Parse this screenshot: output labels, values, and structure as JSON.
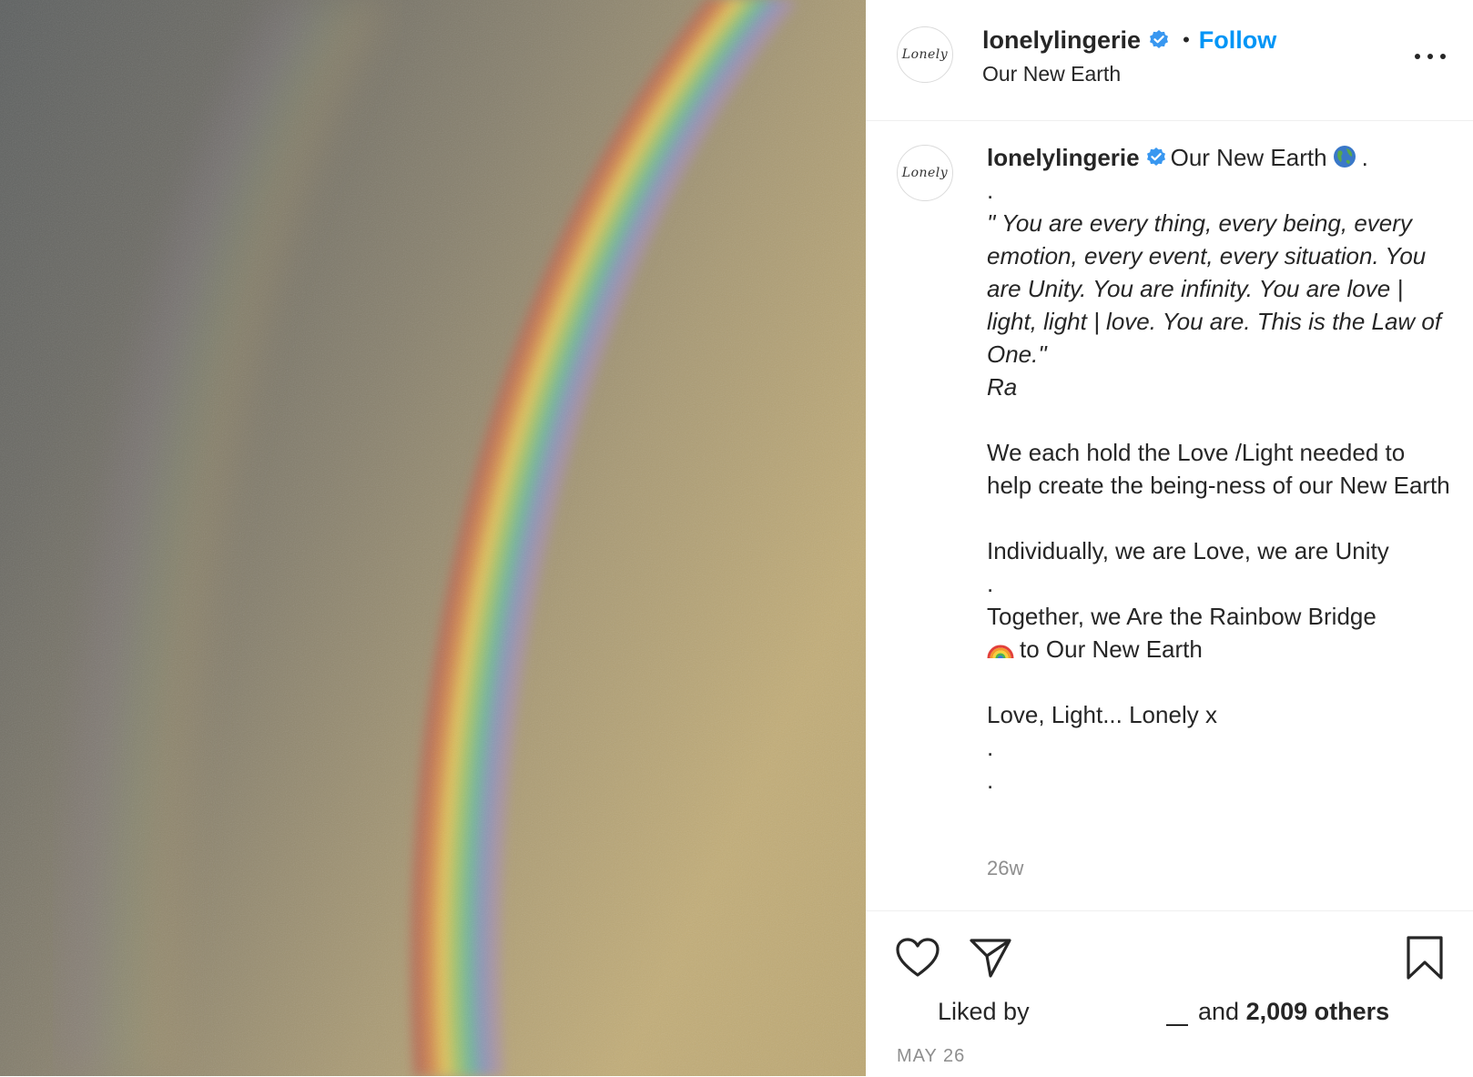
{
  "colors": {
    "accent": "#0095f6",
    "verified": "#3897f0",
    "text": "#262626",
    "muted": "#8e8e8e"
  },
  "photo": {
    "subject": "rainbow-arc-photo"
  },
  "header": {
    "avatar_text": "Lonely",
    "username": "lonelylingerie",
    "separator": "•",
    "follow_label": "Follow",
    "location": "Our New Earth",
    "more_icon": "more-horizontal-icon"
  },
  "caption": {
    "avatar_text": "Lonely",
    "username": "lonelylingerie",
    "first_text": "Our New Earth",
    "first_suffix": ".",
    "dot1": ".",
    "quote": "\" You are every thing, every being, every emotion, every event, every situation. You are Unity. You are infinity. You are love | light, light | love. You are. This is the Law of One.\"",
    "attribution": "Ra",
    "para1": "We each hold the Love /Light needed to help create the being-ness of our New Earth",
    "para2": "Individually, we are Love, we are Unity",
    "dot2": ".",
    "para3_a": "Together, we Are the Rainbow Bridge",
    "para3_b": "to Our New Earth",
    "para4": "Love, Light... Lonely x",
    "dot3": ".",
    "dot4": ".",
    "time_ago": "26w"
  },
  "actions": {
    "like_icon": "heart-icon",
    "share_icon": "paper-plane-icon",
    "save_icon": "bookmark-icon",
    "liked_by": "Liked by",
    "and_text": "and",
    "others": "2,009 others",
    "date": "MAY 26"
  }
}
